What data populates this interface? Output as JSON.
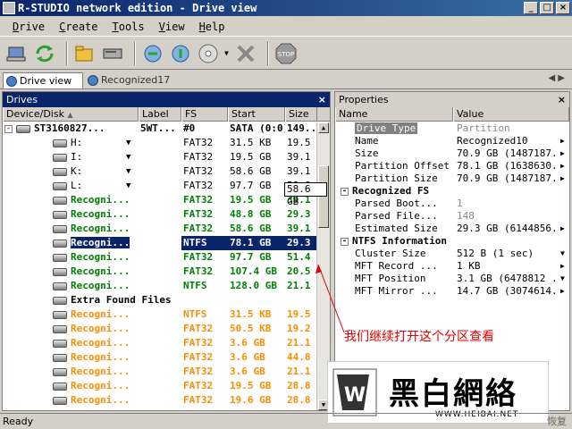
{
  "window": {
    "title": "R-STUDIO network edition - Drive view"
  },
  "menu": [
    {
      "key": "D",
      "rest": "rive"
    },
    {
      "key": "C",
      "rest": "reate"
    },
    {
      "key": "T",
      "rest": "ools"
    },
    {
      "key": "V",
      "rest": "iew"
    },
    {
      "key": "H",
      "rest": "elp"
    }
  ],
  "tabs": {
    "drive_view": "Drive view",
    "recognized": "Recognized17"
  },
  "drives": {
    "title": "Drives",
    "columns": [
      "Device/Disk",
      "Label",
      "FS",
      "Start",
      "Size"
    ],
    "disk": {
      "name": "ST3160827...",
      "label": "5WT...",
      "fs": "#0",
      "start": "SATA (0:0)",
      "size": "149..."
    },
    "partitions": [
      {
        "name": "H:",
        "fs": "FAT32",
        "start": "31.5 KB",
        "size": "19.5 G"
      },
      {
        "name": "I:",
        "fs": "FAT32",
        "start": "19.5 GB",
        "size": "39.1 G"
      },
      {
        "name": "K:",
        "fs": "FAT32",
        "start": "58.6 GB",
        "size": "39.1 G"
      },
      {
        "name": "L:",
        "fs": "FAT32",
        "start": "97.7 GB",
        "size": "58.6 GB"
      }
    ],
    "recognized": [
      {
        "name": "Recogni...",
        "fs": "FAT32",
        "start": "19.5 GB",
        "size": "39.1"
      },
      {
        "name": "Recogni...",
        "fs": "FAT32",
        "start": "48.8 GB",
        "size": "29.3"
      },
      {
        "name": "Recogni...",
        "fs": "FAT32",
        "start": "58.6 GB",
        "size": "39.1"
      },
      {
        "name": "Recogni...",
        "fs": "NTFS",
        "start": "78.1 GB",
        "size": "29.3"
      },
      {
        "name": "Recogni...",
        "fs": "FAT32",
        "start": "97.7 GB",
        "size": "51.4"
      },
      {
        "name": "Recogni...",
        "fs": "FAT32",
        "start": "107.4 GB",
        "size": "20.5"
      },
      {
        "name": "Recogni...",
        "fs": "NTFS",
        "start": "128.0 GB",
        "size": "21.1"
      }
    ],
    "extra_label": "Extra Found Files",
    "extra": [
      {
        "name": "Recogni...",
        "fs": "NTFS",
        "start": "31.5 KB",
        "size": "19.5"
      },
      {
        "name": "Recogni...",
        "fs": "FAT32",
        "start": "50.5 KB",
        "size": "19.2"
      },
      {
        "name": "Recogni...",
        "fs": "FAT32",
        "start": "3.6 GB",
        "size": "21.1"
      },
      {
        "name": "Recogni...",
        "fs": "FAT32",
        "start": "3.6 GB",
        "size": "44.8"
      },
      {
        "name": "Recogni...",
        "fs": "FAT32",
        "start": "3.6 GB",
        "size": "21.1"
      },
      {
        "name": "Recogni...",
        "fs": "FAT32",
        "start": "19.5 GB",
        "size": "28.8"
      },
      {
        "name": "Recogni...",
        "fs": "FAT32",
        "start": "19.6 GB",
        "size": "28.8"
      }
    ],
    "popup_value": "58.6 GB"
  },
  "properties": {
    "title": "Properties",
    "columns": [
      "Name",
      "Value"
    ],
    "rows": [
      {
        "name": "Drive Type",
        "value": "Partition",
        "style": "hl-grey"
      },
      {
        "name": "Name",
        "value": "Recognized10",
        "style": "arrow"
      },
      {
        "name": "Size",
        "value": "70.9 GB (1487187...",
        "style": "arrow"
      },
      {
        "name": "Partition Offset",
        "value": "78.1 GB (1638630...",
        "style": "arrow"
      },
      {
        "name": "Partition Size",
        "value": "70.9 GB (1487187...",
        "style": "arrow"
      }
    ],
    "group1": "Recognized FS",
    "rows2": [
      {
        "name": "Parsed Boot...",
        "value": "1",
        "style": "grey"
      },
      {
        "name": "Parsed File...",
        "value": "148",
        "style": "grey"
      },
      {
        "name": "Estimated Size",
        "value": "29.3 GB (6144856...",
        "style": "arrow"
      }
    ],
    "group2": "NTFS Information",
    "rows3": [
      {
        "name": "Cluster Size",
        "value": "512 B (1 sec)",
        "style": "drop"
      },
      {
        "name": "MFT Record ...",
        "value": "1 KB",
        "style": "arrow"
      },
      {
        "name": "MFT Position",
        "value": "3.1 GB (6478812 ...",
        "style": "drop"
      },
      {
        "name": "MFT Mirror ...",
        "value": "14.7 GB (3074614...",
        "style": "arrow"
      }
    ]
  },
  "annotation": "我们继续打开这个分区查看",
  "watermark": {
    "brand": "黑白網絡",
    "url": "WWW.HEIBAI.NET",
    "logo": "W"
  },
  "status": {
    "left": "Ready",
    "right": "恢复"
  }
}
